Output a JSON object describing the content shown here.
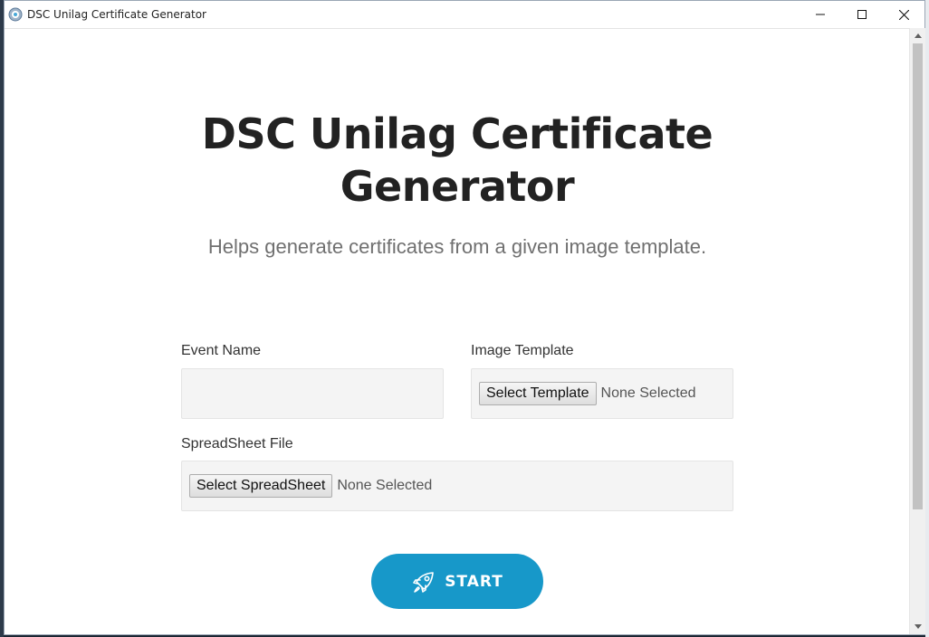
{
  "window": {
    "title": "DSC Unilag Certificate Generator"
  },
  "header": {
    "title": "DSC Unilag Certificate Generator",
    "subtitle": "Helps generate certificates from a given image template."
  },
  "form": {
    "event_name": {
      "label": "Event Name",
      "value": ""
    },
    "image_template": {
      "label": "Image Template",
      "button_label": "Select Template",
      "status": "None Selected"
    },
    "spreadsheet": {
      "label": "SpreadSheet File",
      "button_label": "Select SpreadSheet",
      "status": "None Selected"
    }
  },
  "actions": {
    "start_label": "START",
    "start_icon": "rocket-icon"
  },
  "colors": {
    "accent": "#1798c9",
    "title_text": "#222222",
    "subtitle_text": "#707070",
    "field_bg": "#f4f4f4"
  }
}
